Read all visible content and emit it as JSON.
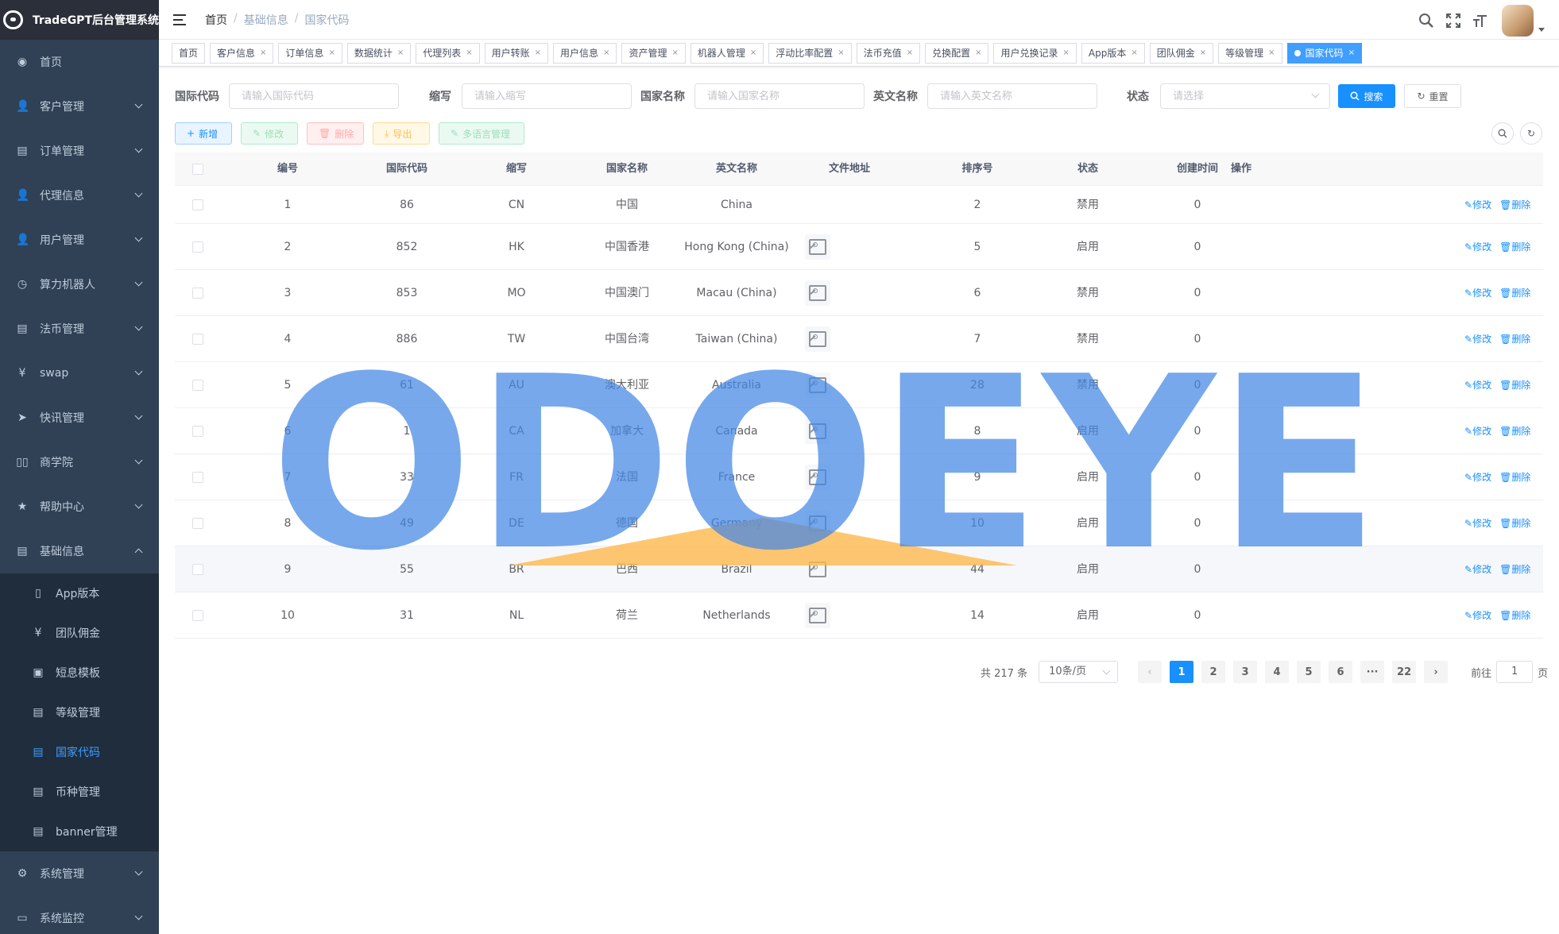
{
  "app": {
    "title": "TradeGPT后台管理系统"
  },
  "sidebar": {
    "items": [
      {
        "label": "首页",
        "icon": "dashboard-icon"
      },
      {
        "label": "客户管理",
        "icon": "user-icon"
      },
      {
        "label": "订单管理",
        "icon": "document-icon"
      },
      {
        "label": "代理信息",
        "icon": "user-icon"
      },
      {
        "label": "用户管理",
        "icon": "user-icon"
      },
      {
        "label": "算力机器人",
        "icon": "clock-icon"
      },
      {
        "label": "法币管理",
        "icon": "document-icon"
      },
      {
        "label": "swap",
        "icon": "yen-icon"
      },
      {
        "label": "快讯管理",
        "icon": "send-icon"
      },
      {
        "label": "商学院",
        "icon": "book-icon"
      },
      {
        "label": "帮助中心",
        "icon": "star-icon"
      },
      {
        "label": "基础信息",
        "icon": "document-icon"
      }
    ],
    "submenu": [
      {
        "label": "App版本",
        "icon": "phone-icon"
      },
      {
        "label": "团队佣金",
        "icon": "yen-icon"
      },
      {
        "label": "短息模板",
        "icon": "message-icon"
      },
      {
        "label": "等级管理",
        "icon": "document-icon"
      },
      {
        "label": "国家代码",
        "icon": "document-icon"
      },
      {
        "label": "币种管理",
        "icon": "document-icon"
      },
      {
        "label": "banner管理",
        "icon": "document-icon"
      }
    ],
    "bottom": [
      {
        "label": "系统管理",
        "icon": "gear-icon"
      },
      {
        "label": "系统监控",
        "icon": "monitor-icon"
      }
    ]
  },
  "breadcrumb": {
    "home": "首页",
    "sep": "/",
    "level1": "基础信息",
    "current": "国家代码"
  },
  "tags": [
    "首页",
    "客户信息",
    "订单信息",
    "数据统计",
    "代理列表",
    "用户转账",
    "用户信息",
    "资产管理",
    "机器人管理",
    "浮动比率配置",
    "法币充值",
    "兑换配置",
    "用户兑换记录",
    "App版本",
    "团队佣金",
    "等级管理",
    "国家代码"
  ],
  "tag_close": "×",
  "form": {
    "code_label": "国际代码",
    "code_placeholder": "请输入国际代码",
    "abbr_label": "缩写",
    "abbr_placeholder": "请输入缩写",
    "name_label": "国家名称",
    "name_placeholder": "请输入国家名称",
    "en_label": "英文名称",
    "en_placeholder": "请输入英文名称",
    "status_label": "状态",
    "status_placeholder": "请选择",
    "search_btn": "搜索",
    "reset_btn": "重置"
  },
  "toolbar": {
    "add": "新增",
    "edit": "修改",
    "delete": "删除",
    "export": "导出",
    "multilang": "多语言管理"
  },
  "table": {
    "headers": [
      "编号",
      "国际代码",
      "缩写",
      "国家名称",
      "英文名称",
      "文件地址",
      "排序号",
      "状态",
      "创建时间",
      "操作"
    ],
    "rows": [
      {
        "id": "1",
        "code": "86",
        "abbr": "CN",
        "name": "中国",
        "en": "China",
        "img": false,
        "sort": "2",
        "status": "禁用",
        "created": "0"
      },
      {
        "id": "2",
        "code": "852",
        "abbr": "HK",
        "name": "中国香港",
        "en": "Hong Kong (China)",
        "img": true,
        "sort": "5",
        "status": "启用",
        "created": "0"
      },
      {
        "id": "3",
        "code": "853",
        "abbr": "MO",
        "name": "中国澳门",
        "en": "Macau (China)",
        "img": true,
        "sort": "6",
        "status": "禁用",
        "created": "0"
      },
      {
        "id": "4",
        "code": "886",
        "abbr": "TW",
        "name": "中国台湾",
        "en": "Taiwan (China)",
        "img": true,
        "sort": "7",
        "status": "禁用",
        "created": "0"
      },
      {
        "id": "5",
        "code": "61",
        "abbr": "AU",
        "name": "澳大利亚",
        "en": "Australia",
        "img": true,
        "sort": "28",
        "status": "禁用",
        "created": "0"
      },
      {
        "id": "6",
        "code": "1",
        "abbr": "CA",
        "name": "加拿大",
        "en": "Canada",
        "img": true,
        "sort": "8",
        "status": "启用",
        "created": "0"
      },
      {
        "id": "7",
        "code": "33",
        "abbr": "FR",
        "name": "法国",
        "en": "France",
        "img": true,
        "sort": "9",
        "status": "启用",
        "created": "0"
      },
      {
        "id": "8",
        "code": "49",
        "abbr": "DE",
        "name": "德国",
        "en": "Germany",
        "img": true,
        "sort": "10",
        "status": "启用",
        "created": "0"
      },
      {
        "id": "9",
        "code": "55",
        "abbr": "BR",
        "name": "巴西",
        "en": "Brazil",
        "img": true,
        "sort": "44",
        "status": "启用",
        "created": "0"
      },
      {
        "id": "10",
        "code": "31",
        "abbr": "NL",
        "name": "荷兰",
        "en": "Netherlands",
        "img": true,
        "sort": "14",
        "status": "启用",
        "created": "0"
      }
    ],
    "op_edit": "修改",
    "op_delete": "删除"
  },
  "pagination": {
    "total": "共 217 条",
    "page_size": "10条/页",
    "pages": [
      "1",
      "2",
      "3",
      "4",
      "5",
      "6",
      "···",
      "22"
    ],
    "current": "1",
    "goto_label": "前往",
    "goto_value": "1",
    "goto_suffix": "页"
  },
  "watermark": {
    "text": "ODOEYE"
  },
  "colors": {
    "sidebar_bg": "#304156",
    "primary": "#1890ff",
    "active_menu": "#409eff"
  }
}
